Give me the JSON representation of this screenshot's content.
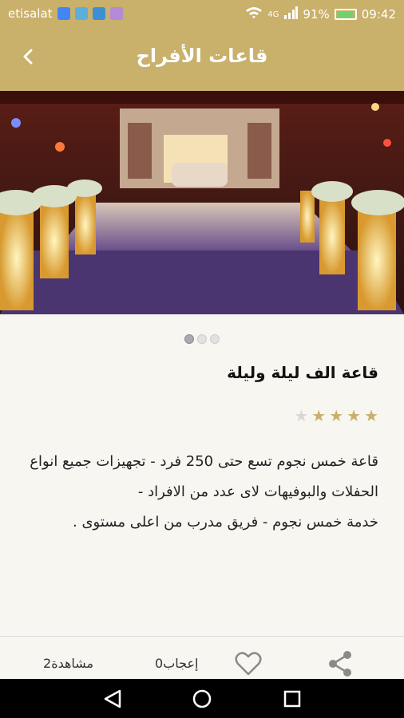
{
  "status_bar": {
    "carrier": "etisalat",
    "network": "4G",
    "battery_percent": "91%",
    "battery_level": 0.91,
    "time": "09:42"
  },
  "app_bar": {
    "title": "قاعات الأفراح",
    "back_icon": "chevron-left-icon"
  },
  "gallery": {
    "image_alt": "wedding-hall-photo",
    "page_count": 3,
    "active_page": 1
  },
  "venue": {
    "name": "قاعة الف ليلة وليلة",
    "rating": 4,
    "rating_max": 5,
    "description": "قاعة خمس نجوم تسع حتى 250 فرد - تجهيزات جميع انواع الحفلات والبوفيهات لاى عدد من الافراد -\nخدمة خمس نجوم - فريق مدرب من اعلى مستوى ."
  },
  "actions": {
    "views_label": "2مشاهدة",
    "likes_label": "0إعجاب",
    "like_icon": "heart-icon",
    "share_icon": "share-icon"
  },
  "colors": {
    "primary": "#c9b06b",
    "background": "#f8f6f1",
    "star_on": "#c9b06b",
    "star_off": "#d8d8d8"
  }
}
